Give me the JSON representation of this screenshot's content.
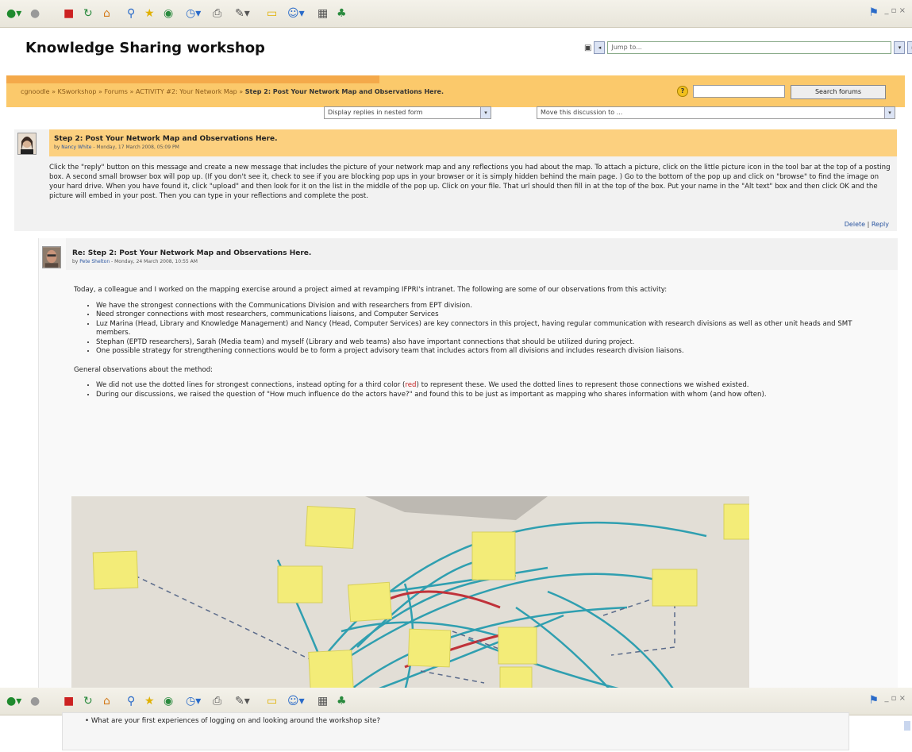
{
  "toolbar": {
    "buttons": [
      "back-icon",
      "forward-icon",
      "stop-icon",
      "refresh-icon",
      "home-icon",
      "search-icon",
      "favorites-icon",
      "media-icon",
      "history-icon",
      "mail-icon",
      "print-icon",
      "edit-icon",
      "discuss-icon",
      "messenger-icon",
      "research-icon"
    ],
    "window_controls": "_ ▫ ×"
  },
  "site": {
    "title": "Knowledge Sharing workshop"
  },
  "jump": {
    "label": "Jump to..."
  },
  "nav": {
    "crumb_1": "cgnoodle",
    "crumb_2": "KSworkshop",
    "crumb_3": "Forums",
    "crumb_4": "ACTIVITY #2:  Your Network Map",
    "crumb_current": "Step 2: Post Your Network Map and Observations Here.",
    "sep": " » ",
    "search_button": "Search forums"
  },
  "display": {
    "mode_select": "Display replies in nested form",
    "move_select": "Move this discussion to ..."
  },
  "post1": {
    "title": "Step 2: Post Your Network Map and Observations Here.",
    "by_prefix": "by ",
    "author": "Nancy White",
    "date": " - Monday, 17 March 2008, 05:09 PM",
    "body": "Click the \"reply\" button on this message and create a new message that includes the picture of your network map and any reflections you had about the map. To attach a picture, click on the little picture icon in the tool bar at the top of a posting box. A second small browser box will pop up. (If you don't see it, check to see if you are blocking pop ups in your browser or it is simply hidden behind the main page. ) Go to the bottom of the pop up and click on \"browse\" to find the image on your hard drive. When you have found it, click \"upload\" and then look for it on the list in the middle of the pop up. Click on your file. That url should then fill in at the top of the box. Put your name in the \"Alt text\" box and then click OK and the picture will embed in your post. Then you can type in your reflections and complete the post.",
    "delete": "Delete",
    "sep": " | ",
    "reply": "Reply"
  },
  "post2": {
    "title": "Re: Step 2: Post Your Network Map and Observations Here.",
    "by_prefix": "by ",
    "author": "Pete Shelton",
    "date": " - Monday, 24 March 2008, 10:55 AM",
    "intro": "Today, a colleague and I worked on the mapping exercise around a project aimed at revamping IFPRI's intranet. The following are some of our observations from this activity:",
    "bullets": [
      "We have the strongest connections with the Communications Division and with researchers from EPT division.",
      "Need stronger connections with most researchers, communications liaisons, and Computer Services",
      "Luz Marina (Head, Library and Knowledge Management) and Nancy (Head, Computer Services) are key connectors in this project, having regular communication with research divisions as well as other unit heads and SMT members.",
      "Stephan (EPTD researchers), Sarah (Media team) and myself (Library and web teams) also have important connections that should be utilized during project.",
      "One possible strategy for strengthening connections would be to form a project advisory team that includes actors from all divisions and includes research division liaisons."
    ],
    "method_heading": "General observations about the method:",
    "method_1_before": "We did not use the dotted lines for strongest connections, instead opting for a third color (",
    "method_1_red": "red",
    "method_1_after": ") to represent these. We used the dotted lines to represent those connections we wished existed.",
    "method_2": "During our discussions, we raised the question of \"How much influence do the actors have?\" and found this to be just as important as mapping who shares information with whom (and how often)."
  },
  "lower": {
    "bullet": "What are your first experiences of logging on and looking around the workshop site?"
  },
  "colors": {
    "nav_bg": "#fbc96b",
    "nav_strip": "#f4a94a",
    "post_head": "#fcd07f",
    "link": "#2a55a0",
    "sticky": "#f3ec78",
    "arrow": "#2f9fb0",
    "red_arrow": "#c0323a"
  }
}
